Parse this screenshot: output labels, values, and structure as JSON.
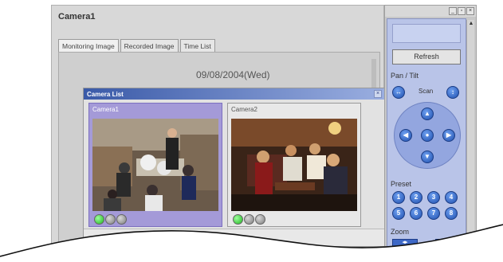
{
  "main_window": {
    "title": "Camera1",
    "tabs": [
      {
        "label": "Monitoring Image",
        "active": true
      },
      {
        "label": "Recorded Image",
        "active": false
      },
      {
        "label": "Time List",
        "active": false
      }
    ],
    "date": "09/08/2004(Wed)"
  },
  "camera_list": {
    "title": "Camera List",
    "cameras": [
      {
        "label": "Camera1",
        "selected": true,
        "status": [
          "green",
          "gray",
          "gray"
        ]
      },
      {
        "label": "Camera2",
        "selected": false,
        "status": [
          "green",
          "gray",
          "gray"
        ]
      }
    ]
  },
  "control_panel": {
    "refresh_label": "Refresh",
    "pan_tilt_label": "Pan / Tilt",
    "scan_label": "Scan",
    "preset_label": "Preset",
    "presets": [
      "1",
      "2",
      "3",
      "4",
      "5",
      "6",
      "7",
      "8"
    ],
    "zoom_label": "Zoom"
  },
  "colors": {
    "selected_camera_bg": "#a49ad8",
    "panel_bg": "#b9c4e8",
    "button_blue": "#2d5fc4",
    "status_green": "#1fb51f",
    "status_gray": "#7d7d7d"
  }
}
